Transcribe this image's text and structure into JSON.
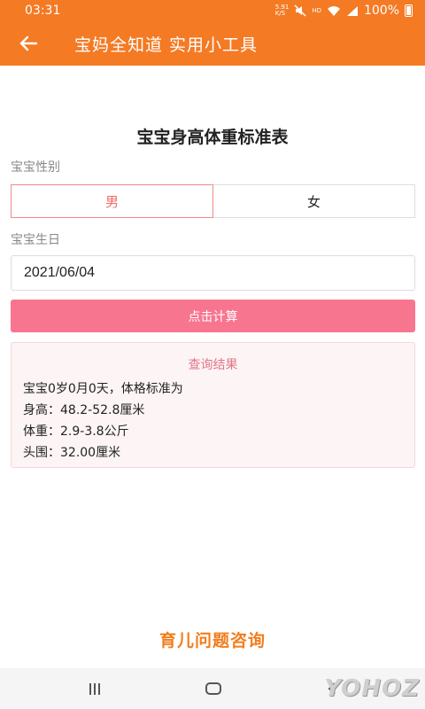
{
  "status_bar": {
    "time": "03:31",
    "net_speed_top": "5.91",
    "net_speed_bottom": "K/S",
    "hd": "HD",
    "battery": "100%"
  },
  "header": {
    "title": "宝妈全知道 实用小工具"
  },
  "page": {
    "title": "宝宝身高体重标准表",
    "gender_label": "宝宝性别",
    "gender_options": [
      "男",
      "女"
    ],
    "selected_gender": "男",
    "birthday_label": "宝宝生日",
    "birthday_value": "2021/06/04",
    "calc_button": "点击计算"
  },
  "result": {
    "title": "查询结果",
    "lines": [
      "宝宝0岁0月0天，体格标准为",
      "身高：48.2-52.8厘米",
      "体重：2.9-3.8公斤",
      "头围：32.00厘米"
    ]
  },
  "consult": {
    "label": "育儿问题咨询"
  },
  "watermark": "YOHOZ",
  "colors": {
    "brand_orange": "#f47a24",
    "button_pink": "#f87590",
    "result_title": "#e07588"
  }
}
